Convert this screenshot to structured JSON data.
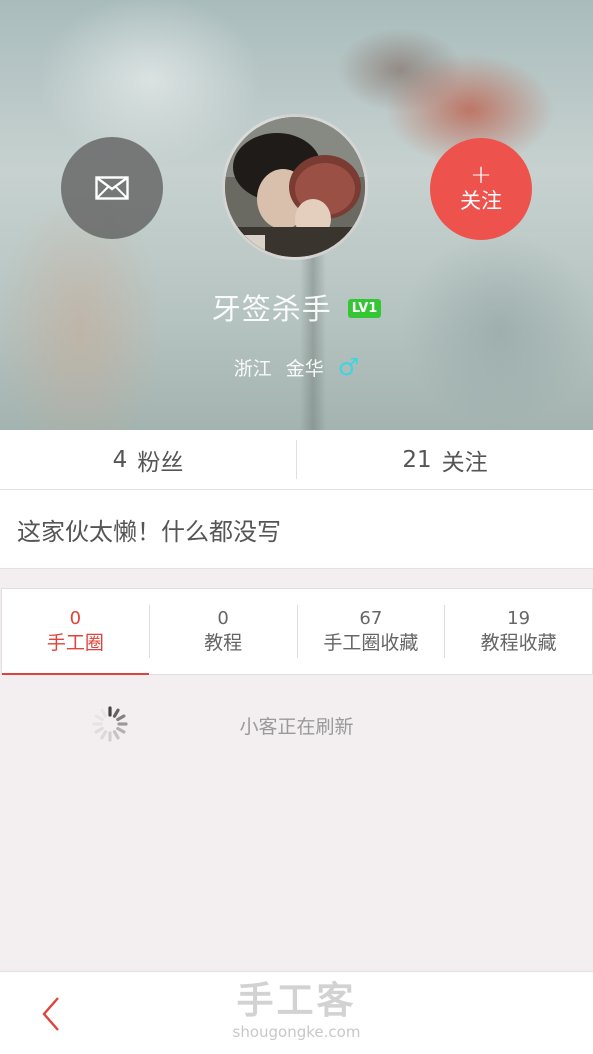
{
  "profile": {
    "username": "牙签杀手",
    "level": "LV1",
    "province": "浙江",
    "city": "金华",
    "gender_symbol": "♂",
    "message_icon": "envelope-icon",
    "follow_plus": "+",
    "follow_label": "关注"
  },
  "stats": {
    "fans": {
      "count": "4",
      "label": "粉丝"
    },
    "following": {
      "count": "21",
      "label": "关注"
    }
  },
  "bio": "这家伙太懒！什么都没写",
  "tabs": [
    {
      "count": "0",
      "label": "手工圈",
      "active": true
    },
    {
      "count": "0",
      "label": "教程",
      "active": false
    },
    {
      "count": "67",
      "label": "手工圈收藏",
      "active": false
    },
    {
      "count": "19",
      "label": "教程收藏",
      "active": false
    }
  ],
  "loading": {
    "text": "小客正在刷新",
    "icon": "spinner-icon"
  },
  "bottom": {
    "back_icon": "chevron-left-icon",
    "brand_name": "手工客",
    "brand_url": "shougongke.com"
  },
  "colors": {
    "accent": "#e0433b",
    "follow_button": "#ee524d",
    "level_badge": "#35c634",
    "gender": "#3fd4df"
  }
}
